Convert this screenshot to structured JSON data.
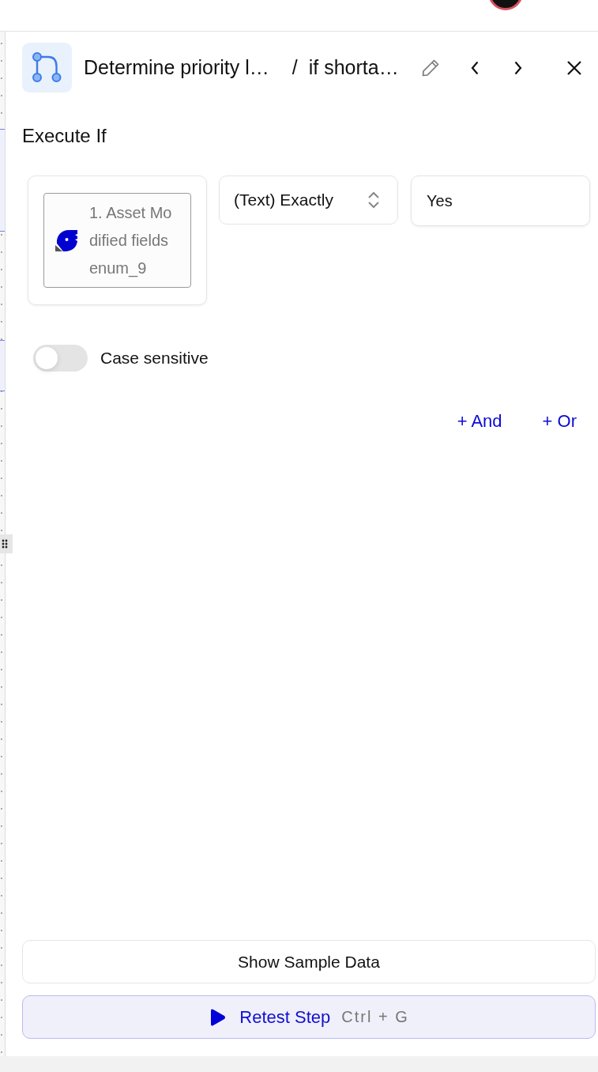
{
  "panel_header": {
    "title": "Determine priority l…",
    "separator": "/",
    "subtitle": "if shorta…"
  },
  "section_title": "Execute If",
  "condition": {
    "field": "1. Asset Modified fields enum_9",
    "operator": "(Text) Exactly",
    "value": "Yes"
  },
  "case_sensitive": {
    "label": "Case sensitive",
    "on": false
  },
  "add_links": [
    "+ And",
    "+ Or"
  ],
  "buttons": [
    {
      "kind": "outline",
      "label": "Show Sample Data"
    },
    {
      "kind": "primary",
      "label": "Retest Step",
      "shortcut": "Ctrl + G"
    }
  ]
}
